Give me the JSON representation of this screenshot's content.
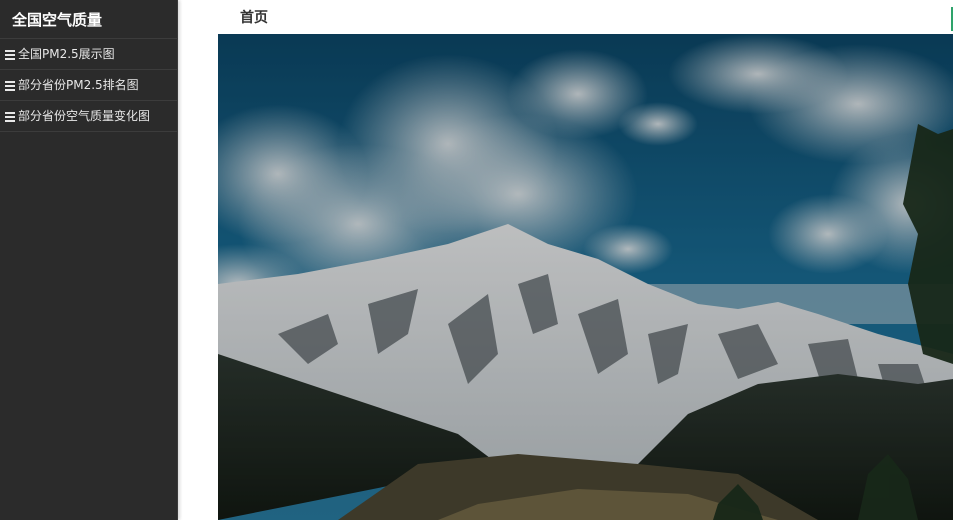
{
  "sidebar": {
    "title": "全国空气质量",
    "items": [
      {
        "label": "全国PM2.5展示图",
        "icon": "menu-icon"
      },
      {
        "label": "部分省份PM2.5排名图",
        "icon": "menu-icon"
      },
      {
        "label": "部分省份空气质量变化图",
        "icon": "menu-icon"
      }
    ]
  },
  "header": {
    "title": "首页",
    "accent_color": "#2ea36b"
  },
  "hero": {
    "subject": "snow-capped-mountain-landscape"
  },
  "colors": {
    "sidebar_bg": "#2b2b2b",
    "sidebar_text": "#e8e8e8",
    "header_bg": "#ffffff"
  }
}
